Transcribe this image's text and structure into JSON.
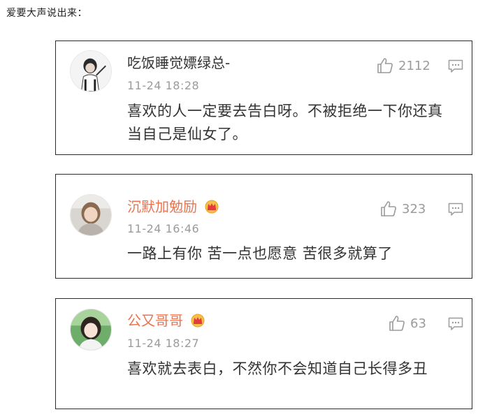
{
  "caption": "爱要大声说出来：",
  "colors": {
    "vip_name": "#eb7350",
    "normal_name": "#333333",
    "meta_gray": "#9b9b9b",
    "border": "#2b2b2b"
  },
  "icons": {
    "like": "thumbs-up-icon",
    "reply": "comment-bubble-icon",
    "badge": "crown-icon"
  },
  "comments": [
    {
      "username": "吃饭睡觉嫖绿总-",
      "time": "11-24 18:28",
      "likes": "2112",
      "text": "喜欢的人一定要去告白呀。不被拒绝一下你还真当自己是仙女了。",
      "vip": false
    },
    {
      "username": "沉默加勉励",
      "time": "11-24 16:46",
      "likes": "323",
      "text": "一路上有你 苦一点也愿意 苦很多就算了",
      "vip": true
    },
    {
      "username": "公又哥哥",
      "time": "11-24 18:27",
      "likes": "63",
      "text": "喜欢就去表白，不然你不会知道自己长得多丑",
      "vip": true
    }
  ]
}
